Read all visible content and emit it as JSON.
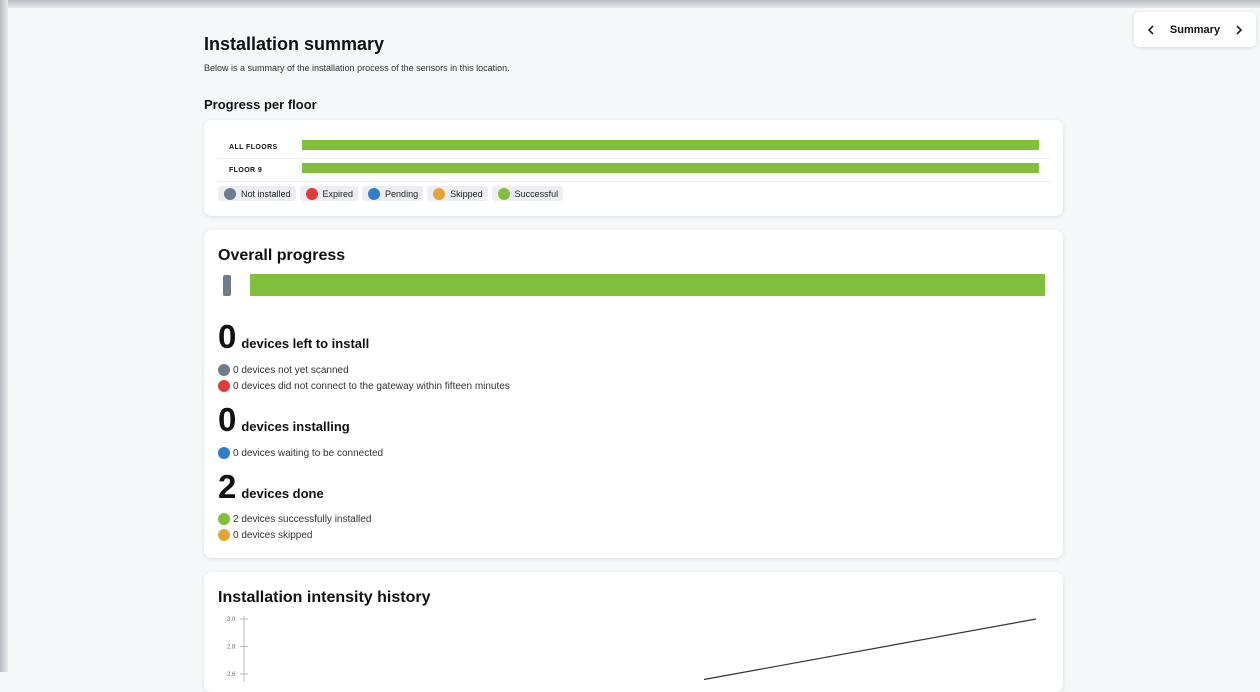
{
  "nav": {
    "label": "Summary"
  },
  "header": {
    "title": "Installation summary",
    "subtitle": "Below is a summary of the installation process of the sensors in this location."
  },
  "progress_per_floor": {
    "title": "Progress per floor",
    "floors": [
      {
        "label": "ALL FLOORS",
        "successful_fraction": 1.0
      },
      {
        "label": "FLOOR 9",
        "successful_fraction": 1.0
      }
    ],
    "legend": [
      {
        "label": "Not installed",
        "color": "#707b8e"
      },
      {
        "label": "Expired",
        "color": "#e23b3b"
      },
      {
        "label": "Pending",
        "color": "#2f7fd1"
      },
      {
        "label": "Skipped",
        "color": "#e3a23a"
      },
      {
        "label": "Successful",
        "color": "#82bf3c"
      }
    ]
  },
  "overall": {
    "title": "Overall progress",
    "successful_fraction": 1.0,
    "left": {
      "count": "0",
      "label": "devices left to install",
      "items": [
        {
          "text": "0 devices not yet scanned",
          "color": "#707b8e"
        },
        {
          "text": "0 devices did not connect to the gateway within fifteen minutes",
          "color": "#e23b3b"
        }
      ]
    },
    "installing": {
      "count": "0",
      "label": "devices installing",
      "items": [
        {
          "text": "0 devices waiting to be connected",
          "color": "#2f7fd1"
        }
      ]
    },
    "done": {
      "count": "2",
      "label": "devices done",
      "items": [
        {
          "text": "2 devices successfully installed",
          "color": "#82bf3c"
        },
        {
          "text": "0 devices skipped",
          "color": "#e3a23a"
        }
      ]
    }
  },
  "history": {
    "title": "Installation intensity history",
    "chart_data": {
      "type": "line",
      "yticks": [
        "3.0",
        "2.8",
        "2.6"
      ],
      "ylim": [
        2.6,
        3.0
      ],
      "series": [
        {
          "values": [
            2.56,
            3.0
          ]
        }
      ]
    }
  }
}
